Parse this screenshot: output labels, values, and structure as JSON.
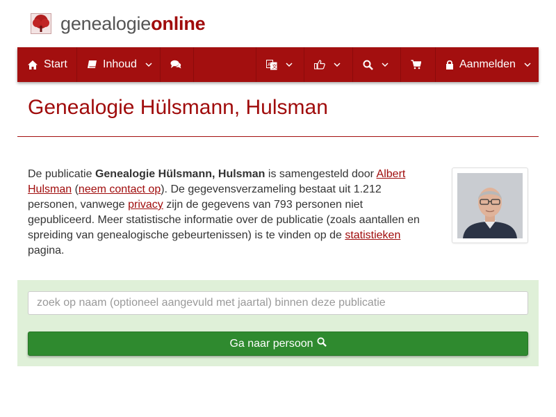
{
  "site": {
    "name_part1": "genealogie",
    "name_part2": "online"
  },
  "nav": {
    "start_label": "Start",
    "contents_label": "Inhoud",
    "login_label": "Aanmelden"
  },
  "page": {
    "title": "Genealogie Hülsmann, Hulsman"
  },
  "intro": {
    "t1": "De publicatie ",
    "pub_name": "Genealogie Hülsmann, Hulsman",
    "t2": " is samengesteld door ",
    "author": "Albert Hulsman",
    "t3": " (",
    "contact": "neem contact op",
    "t4": "). De gegevensverzameling bestaat uit 1.212 personen, vanwege ",
    "privacy": "privacy",
    "t5": " zijn de gegevens van 793 personen niet gepubliceerd. Meer statistische informatie over de publicatie (zoals aantallen en spreiding van genealogische gebeurtenissen) is te vinden op de ",
    "stats": "statistieken",
    "t6": " pagina."
  },
  "search": {
    "placeholder": "zoek op naam (optioneel aangevuld met jaartal) binnen deze publicatie",
    "button_label": "Ga naar persoon"
  },
  "colors": {
    "brand": "#a30f0f",
    "search_bg": "#dff0d8",
    "button": "#2f8a2f"
  }
}
